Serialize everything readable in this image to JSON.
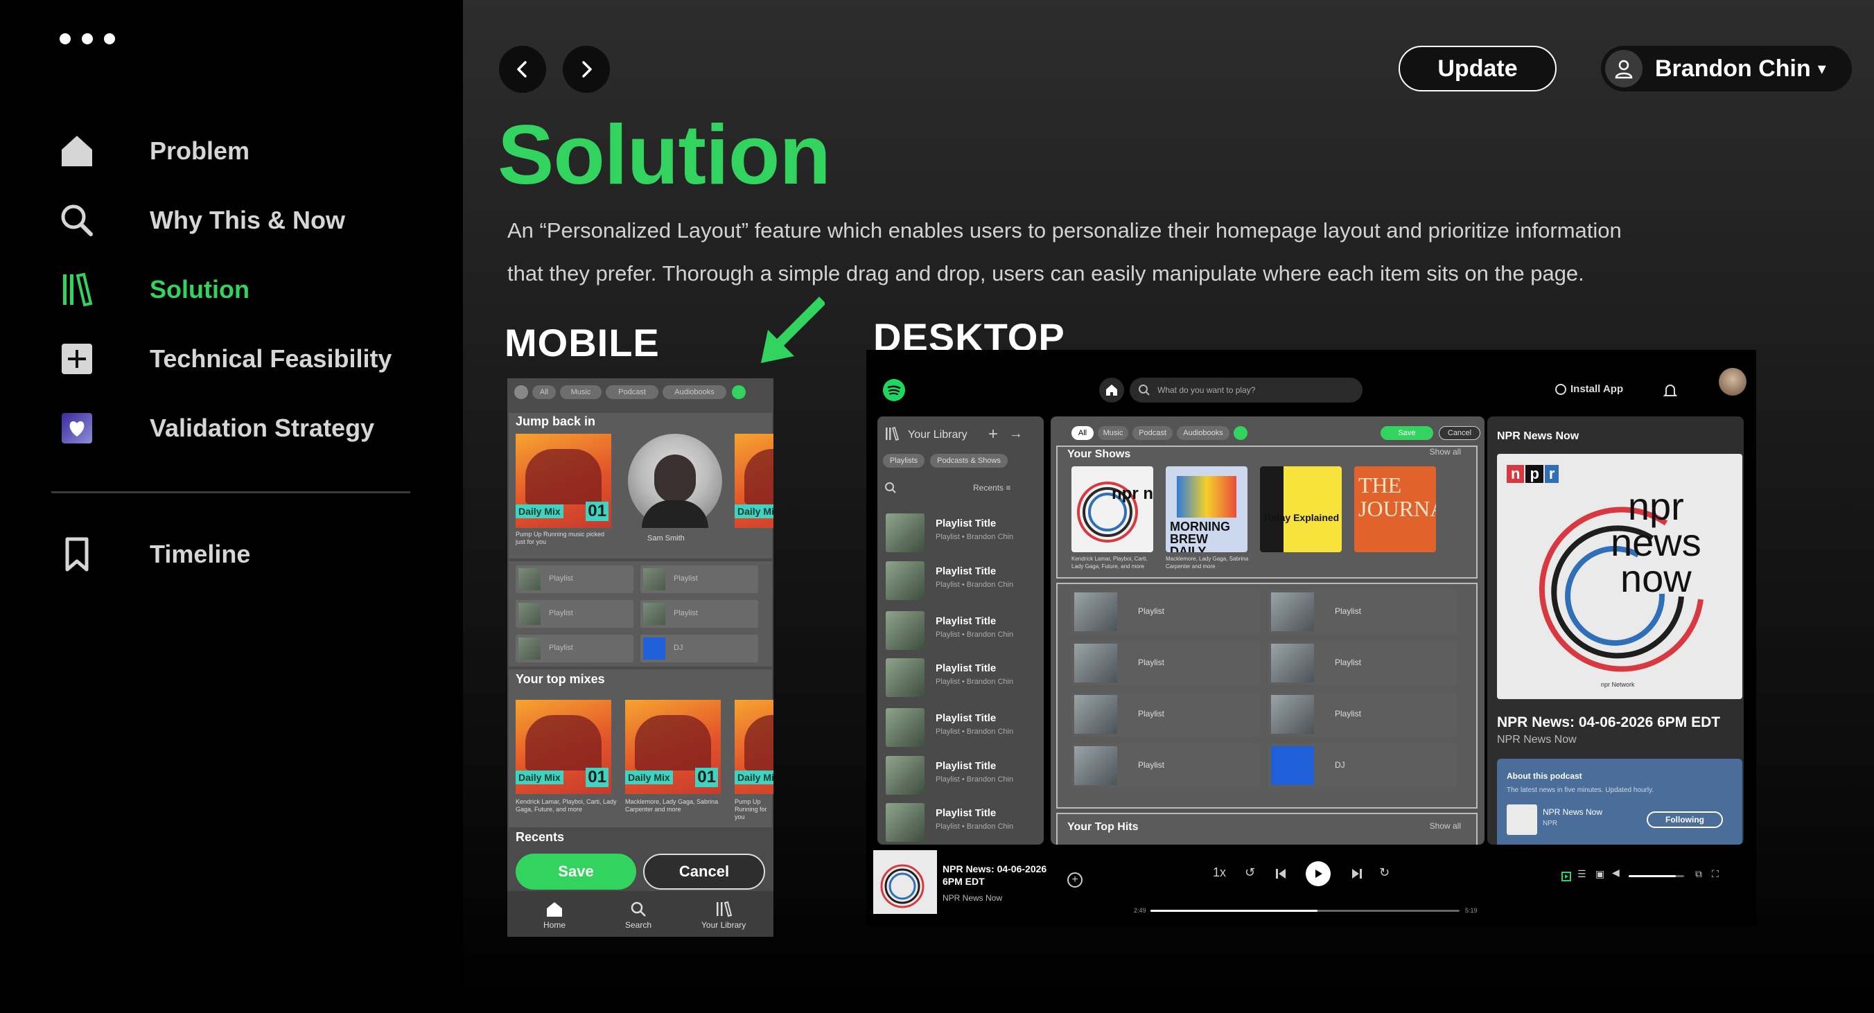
{
  "sidebar": {
    "items": [
      {
        "label": "Problem",
        "icon": "home-icon"
      },
      {
        "label": "Why This & Now",
        "icon": "search-icon"
      },
      {
        "label": "Solution",
        "icon": "library-icon",
        "active": true
      },
      {
        "label": "Technical Feasibility",
        "icon": "plus-square-icon"
      },
      {
        "label": "Validation Strategy",
        "icon": "heart-square-icon"
      }
    ],
    "secondary": [
      {
        "label": "Timeline",
        "icon": "bookmark-icon"
      }
    ]
  },
  "header": {
    "update_label": "Update",
    "user_name": "Brandon Chin",
    "dropdown_glyph": "▾"
  },
  "page": {
    "title": "Solution",
    "description_1": "An “Personalized Layout” feature which enables users to personalize their homepage layout and prioritize information",
    "description_2": "that they prefer. Thorough a simple drag and drop, users can easily manipulate where each item sits on the page.",
    "mobile_label": "MOBILE",
    "desktop_label": "DESKTOP"
  },
  "mobile": {
    "chips": [
      "All",
      "Music",
      "Podcast",
      "Audiobooks"
    ],
    "jump_back_title": "Jump back in",
    "daily_mix_label": "Daily Mix",
    "daily_mix_num": "01",
    "jump_caption": "Pump Up Running music picked just for you",
    "artist_name": "Sam Smith",
    "playlist_label": "Playlist",
    "dj_label": "DJ",
    "top_mixes_title": "Your top mixes",
    "mix_caption_1": "Kendrick Lamar, Playboi, Carti, Lady Gaga, Future, and more",
    "mix_caption_2": "Macklemore, Lady Gaga, Sabrina Carpenter and more",
    "mix_caption_3": "Pump Up Running for you",
    "recents_title": "Recents",
    "save_label": "Save",
    "cancel_label": "Cancel",
    "tabs": [
      "Home",
      "Search",
      "Your Library"
    ]
  },
  "desktop": {
    "search_placeholder": "What do you want to play?",
    "install_label": "Install App",
    "library_title": "Your Library",
    "library_chips": [
      "Playlists",
      "Podcasts & Shows"
    ],
    "recents_label": "Recents",
    "library_item_title": "Playlist Title",
    "library_item_sub": "Playlist • Brandon Chin",
    "filter_chips": [
      "All",
      "Music",
      "Podcast",
      "Audiobooks"
    ],
    "save_label": "Save",
    "cancel_label": "Cancel",
    "your_shows_title": "Your Shows",
    "show_all_label": "Show all",
    "shows": [
      {
        "name": "npr news now",
        "caption": "Kendrick Lamar, Playboi, Carti, Lady Gaga, Future, and more"
      },
      {
        "name": "MORNING BREW DAILY",
        "caption": "Macklemore, Lady Gaga, Sabrina Carpenter and more"
      },
      {
        "name": "Today Explained",
        "caption": ""
      },
      {
        "name": "THE JOURNAL.",
        "caption": ""
      }
    ],
    "playlist_label": "Playlist",
    "dj_label": "DJ",
    "top_hits_title": "Your Top Hits",
    "np_header": "NPR News Now",
    "np_logo_letters": [
      "n",
      "p",
      "r"
    ],
    "np_art_text": [
      "npr",
      "news",
      "now"
    ],
    "np_network": "npr Network",
    "np_title": "NPR News: 04-06-2026 6PM EDT",
    "np_subtitle": "NPR News Now",
    "about_title": "About this podcast",
    "about_desc": "The latest news in five minutes. Updated hourly.",
    "about_show": "NPR News Now",
    "about_show_sub": "NPR",
    "following_label": "Following",
    "player_title_1": "NPR News: 04-06-2026",
    "player_title_2": "6PM EDT",
    "player_sub": "NPR News Now",
    "speed_label": "1x",
    "time_elapsed": "2:49",
    "time_total": "5:19",
    "progress": 0.54,
    "volume": 0.85
  },
  "colors": {
    "accent": "#33d35f",
    "panel": "#4a4a4a",
    "spotify_green": "#1ed760"
  }
}
